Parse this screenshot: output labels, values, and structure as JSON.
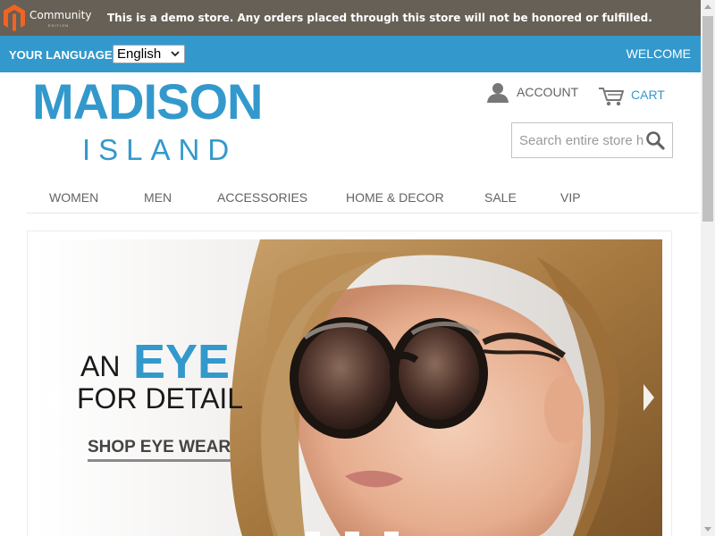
{
  "demo_bar": {
    "logo_text": "Community",
    "logo_subtext": "EDITION",
    "notice": "This is a demo store. Any orders placed through this store will not be honored or fulfilled."
  },
  "language_bar": {
    "label": "YOUR LANGUAGE:",
    "selected_language": "English",
    "welcome": "WELCOME"
  },
  "header": {
    "logo_main": "MADISON",
    "logo_sub": "ISLAND",
    "account_label": "ACCOUNT",
    "cart_label": "CART",
    "search_placeholder": "Search entire store here..."
  },
  "nav": {
    "items": [
      {
        "label": "WOMEN"
      },
      {
        "label": "MEN"
      },
      {
        "label": "ACCESSORIES"
      },
      {
        "label": "HOME & DECOR"
      },
      {
        "label": "SALE"
      },
      {
        "label": "VIP"
      }
    ]
  },
  "hero": {
    "line1_prefix": "AN",
    "line1_highlight": "EYE",
    "line2": "FOR DETAIL",
    "cta": "SHOP EYE WEAR",
    "slide_count": 3
  },
  "colors": {
    "demo_bar_bg": "#666056",
    "brand_blue": "#3399cc",
    "nav_text": "#636363"
  },
  "icons": {
    "account": "user-icon",
    "cart": "cart-icon",
    "search": "search-icon",
    "prev": "chevron-left-icon",
    "next": "chevron-right-icon"
  }
}
